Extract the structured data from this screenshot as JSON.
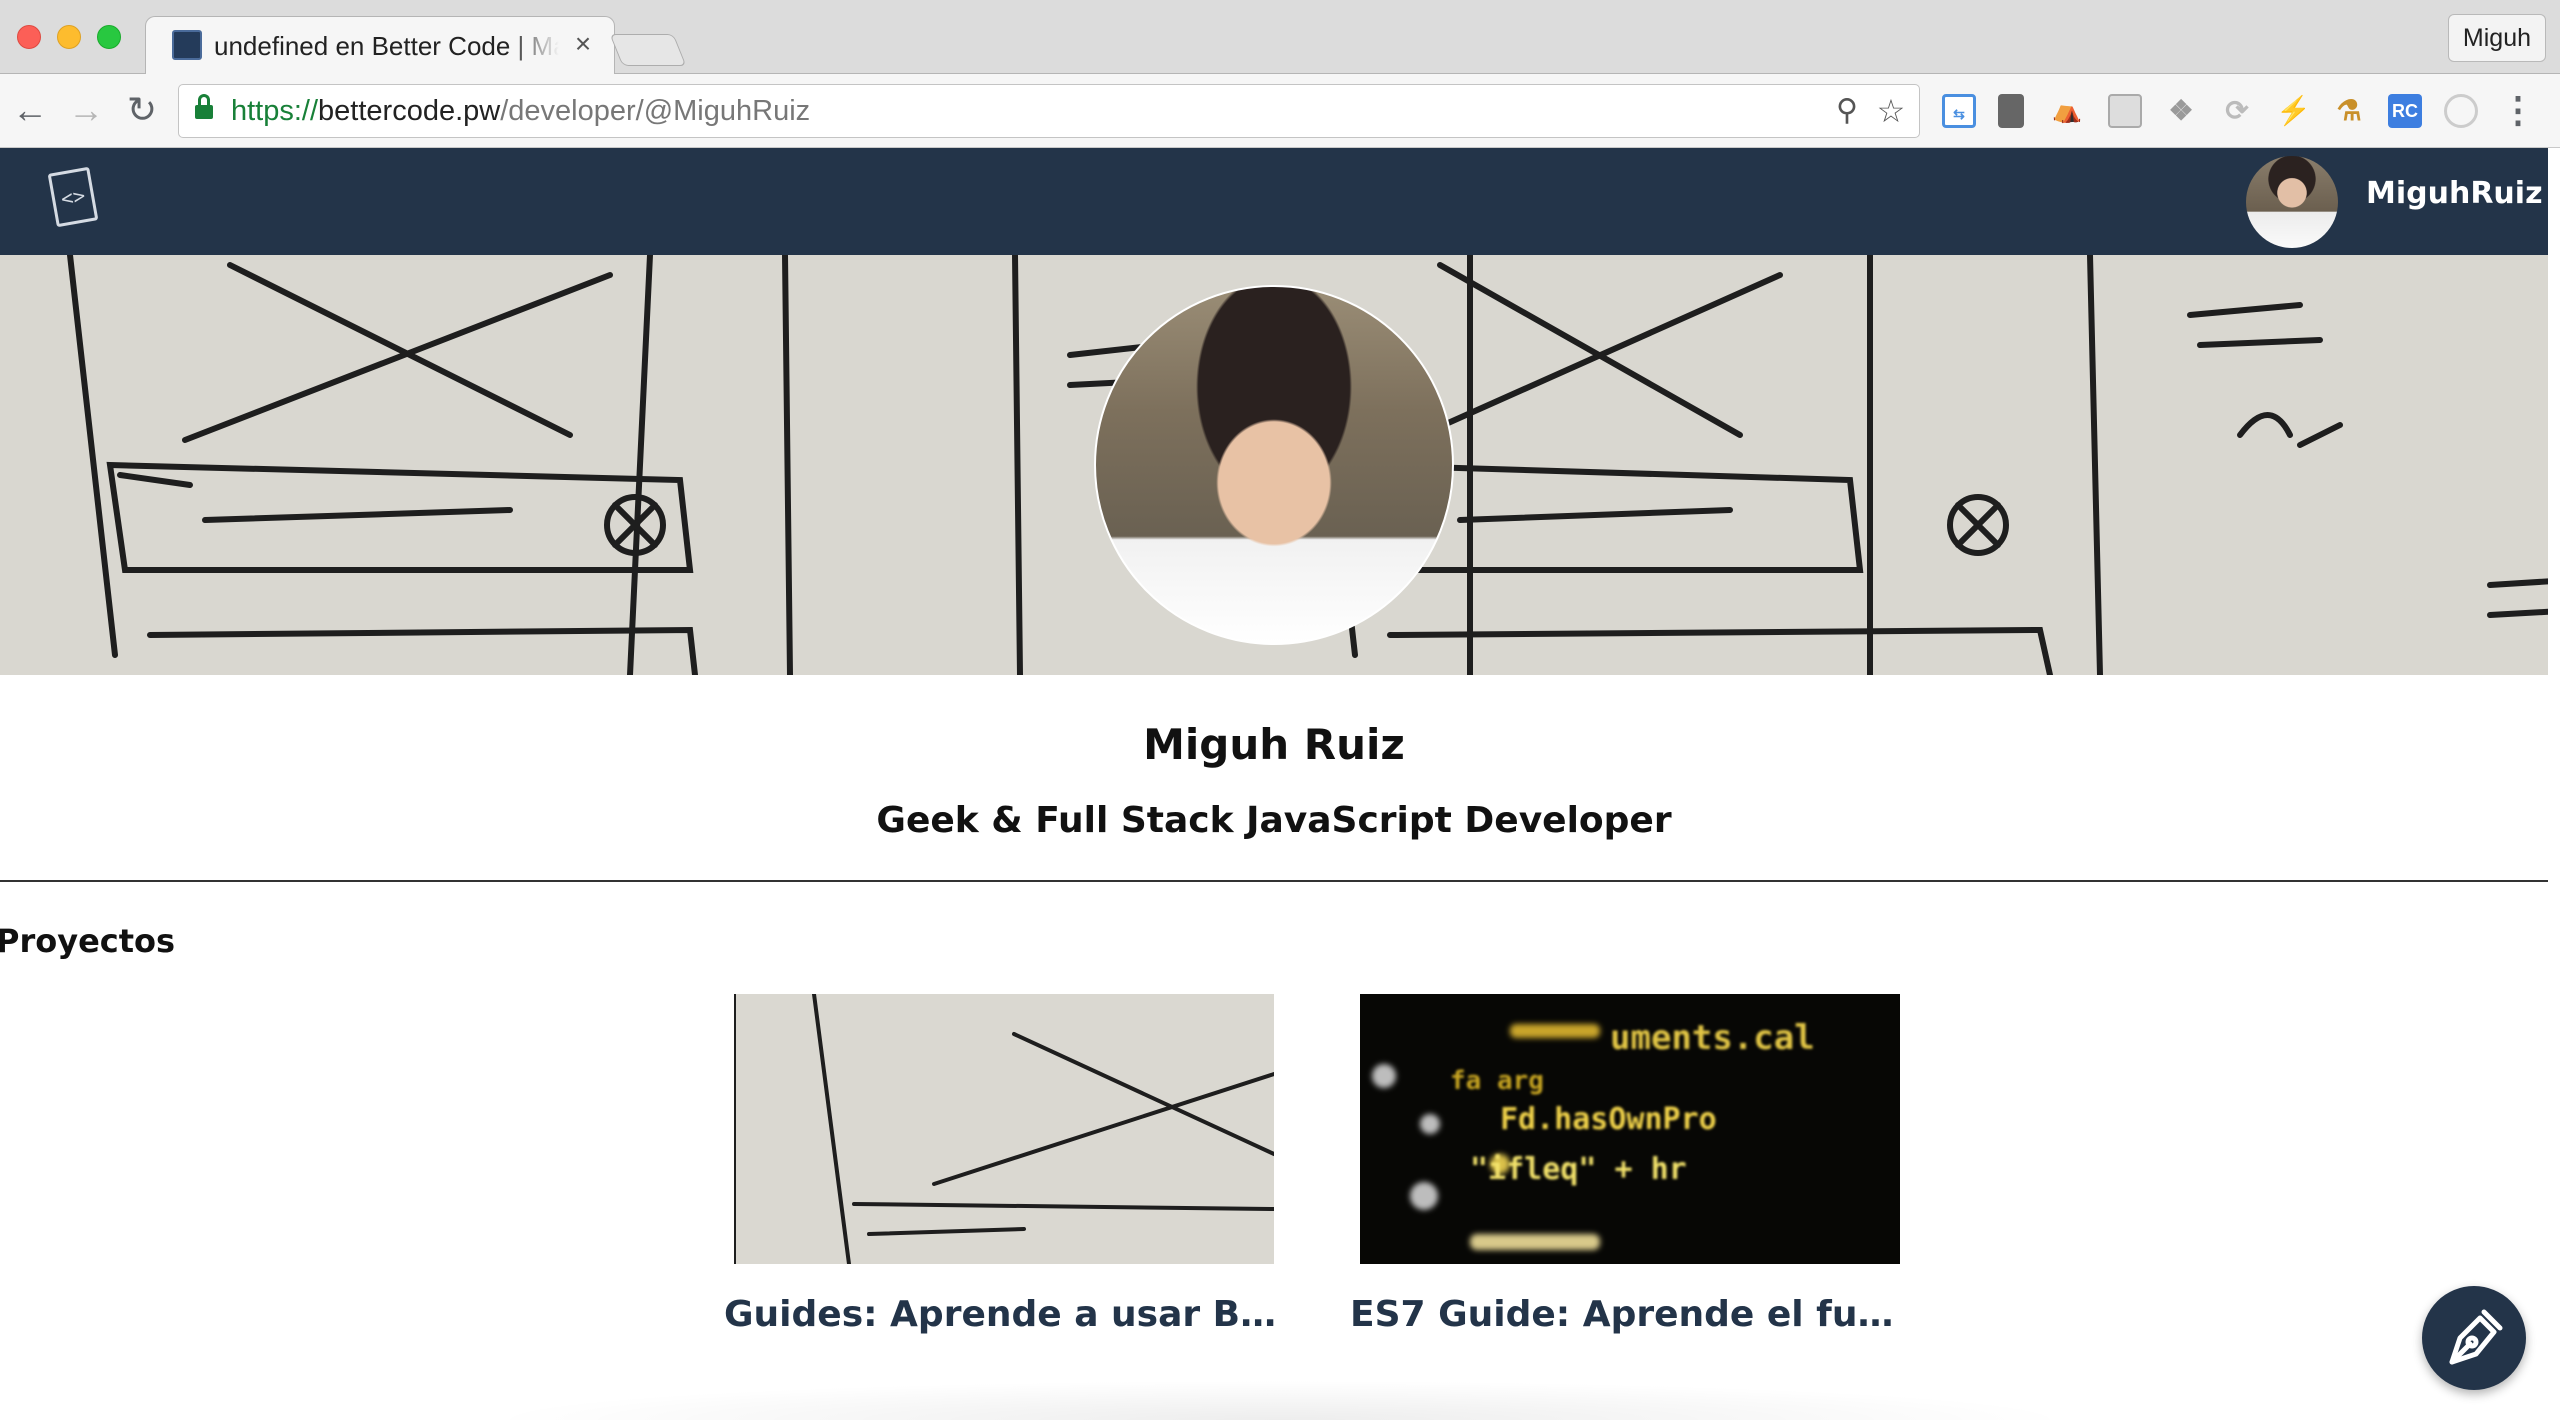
{
  "browser": {
    "tab_title": "undefined en Better Code | Ma",
    "tab_close": "×",
    "profile_name": "Miguh",
    "url_scheme": "https://",
    "url_host": "bettercode.pw",
    "url_path": "/developer/@MiguhRuiz",
    "extensions": [
      "tab-sync-icon",
      "column-icon",
      "island-icon",
      "screenshot-icon",
      "dropbox-icon",
      "sync-icon",
      "bolt-icon",
      "ruler-icon",
      "rc-icon",
      "circle-icon"
    ],
    "rc_label": "RC"
  },
  "header": {
    "logo_glyph": "<>",
    "username": "MiguhRuiz"
  },
  "profile": {
    "name": "Miguh Ruiz",
    "bio": "Geek & Full Stack JavaScript Developer"
  },
  "projects": {
    "section_title": "Proyectos",
    "items": [
      {
        "title": "Guides: Aprende a usar Bett...",
        "thumb": "sketch"
      },
      {
        "title": "ES7 Guide: Aprende el futur...",
        "thumb": "code"
      }
    ]
  },
  "colors": {
    "brand": "#233449",
    "link_green": "#188038"
  }
}
